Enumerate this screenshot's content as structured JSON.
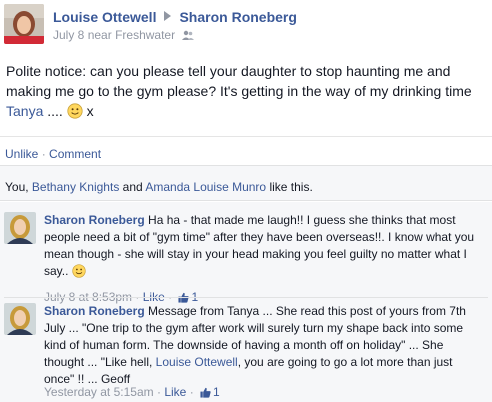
{
  "post": {
    "author": "Louise Ottewell",
    "recipient": "Sharon Roneberg",
    "date": "July 8",
    "near_label": "near",
    "location": "Freshwater",
    "audience_icon": "friends-icon",
    "text_main": "Polite notice: can you please tell your daughter to stop haunting me and making me go to the gym please? It's getting in the way of my drinking time ",
    "tagged": "Tanya",
    "text_tail": " ....",
    "text_end": " x"
  },
  "actions": {
    "unlike": "Unlike",
    "separator": "·",
    "comment": "Comment"
  },
  "likes": {
    "prefix": "You, ",
    "person1": "Bethany Knights",
    "and": " and ",
    "person2": "Amanda Louise Munro",
    "suffix": " like this."
  },
  "comments": [
    {
      "author": "Sharon Roneberg",
      "text": "Ha ha - that made me laugh!! I guess she thinks that most people need a bit of \"gym time\" after they have been overseas!!. I know what you mean though - she will stay in your head making you feel guilty no matter what I say..",
      "time": "July 8 at 8:53pm",
      "like_label": "Like",
      "like_count": "1"
    },
    {
      "author": "Sharon Roneberg",
      "text_before": "Message from Tanya ... She read this post of yours from 7th July ... \"One trip to the gym after work will surely turn my shape back into some kind of human form. The downside of having a month off on holiday\" ... She thought ... \"Like hell, ",
      "mention": "Louise Ottewell",
      "text_after": ", you are going to go a lot more than just once\" !! ... Geoff",
      "time": "Yesterday at 5:15am",
      "like_label": "Like",
      "like_count": "1"
    }
  ],
  "colors": {
    "link": "#3b5998",
    "meta": "#9197a3",
    "background_gray": "#f6f7f9"
  }
}
